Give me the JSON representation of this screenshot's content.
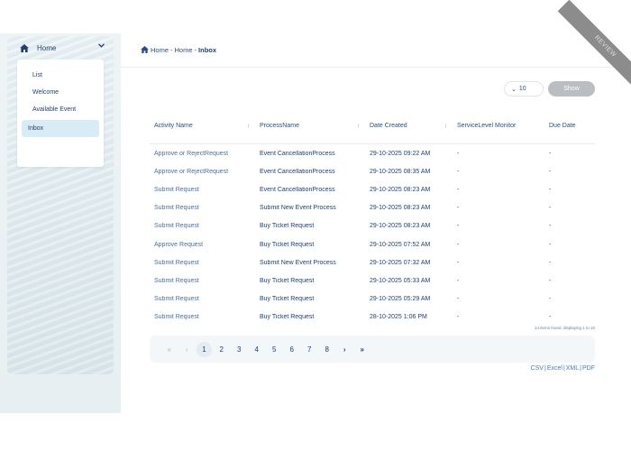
{
  "sidebar": {
    "home_label": "Home",
    "menu_items": [
      "List",
      "Welcome",
      "Available Event",
      "Inbox"
    ],
    "active_item": "Inbox"
  },
  "breadcrumb": {
    "items": [
      "Home",
      "Home",
      "Inbox"
    ],
    "separator": "-"
  },
  "ribbon": {
    "label": "REVIEW"
  },
  "controls": {
    "page_size": "10",
    "show_label": "Show"
  },
  "table": {
    "columns": [
      "Activity Name",
      "ProcessName",
      "Date Created",
      "ServiceLevel Monitor",
      "Due Date"
    ],
    "sort_glyph": "↕",
    "rows": [
      [
        "Approve or RejectRequest",
        "Event CancellationProcess",
        "29-10-2025 09:22 AM",
        "-",
        "-"
      ],
      [
        "Approve or RejectRequest",
        "Event CancellationProcess",
        "29-10-2025 08:35 AM",
        "-",
        "-"
      ],
      [
        "Submit Request",
        "Event CancellationProcess",
        "29-10-2025 08:23 AM",
        "-",
        "-"
      ],
      [
        "Submit Request",
        "Submit New Event Process",
        "29-10-2025 08:23 AM",
        "-",
        "-"
      ],
      [
        "Submit Request",
        "Buy Ticket Request",
        "29-10-2025 08:23 AM",
        "-",
        "-"
      ],
      [
        "Approve Request",
        "Buy Ticket Request",
        "29-10-2025 07:52 AM",
        "-",
        "-"
      ],
      [
        "Submit Request",
        "Submit New Event Process",
        "29-10-2025 07:32 AM",
        "-",
        "-"
      ],
      [
        "Submit Request",
        "Buy Ticket Request",
        "29-10-2025 05:33 AM",
        "-",
        "-"
      ],
      [
        "Submit Request",
        "Buy Ticket Request",
        "29-10-2025 05:29 AM",
        "-",
        "-"
      ],
      [
        "Submit Request",
        "Buy Ticket Request",
        "28-10-2025 1:06 PM",
        "-",
        "-"
      ]
    ]
  },
  "records_info": "14 items found, displaying 1 to 10",
  "pagination": {
    "first": "«",
    "prev": "‹",
    "pages": [
      "1",
      "2",
      "3",
      "4",
      "5",
      "6",
      "7",
      "8"
    ],
    "current": "1",
    "next": "›",
    "last": "»"
  },
  "exports": [
    "CSV",
    "Excel",
    "XML",
    "PDF"
  ],
  "colors": {
    "accent": "#1f3f6e",
    "link": "#4f6f99",
    "active_bg": "#d9ebf5",
    "button_bg": "#b9bec2"
  }
}
